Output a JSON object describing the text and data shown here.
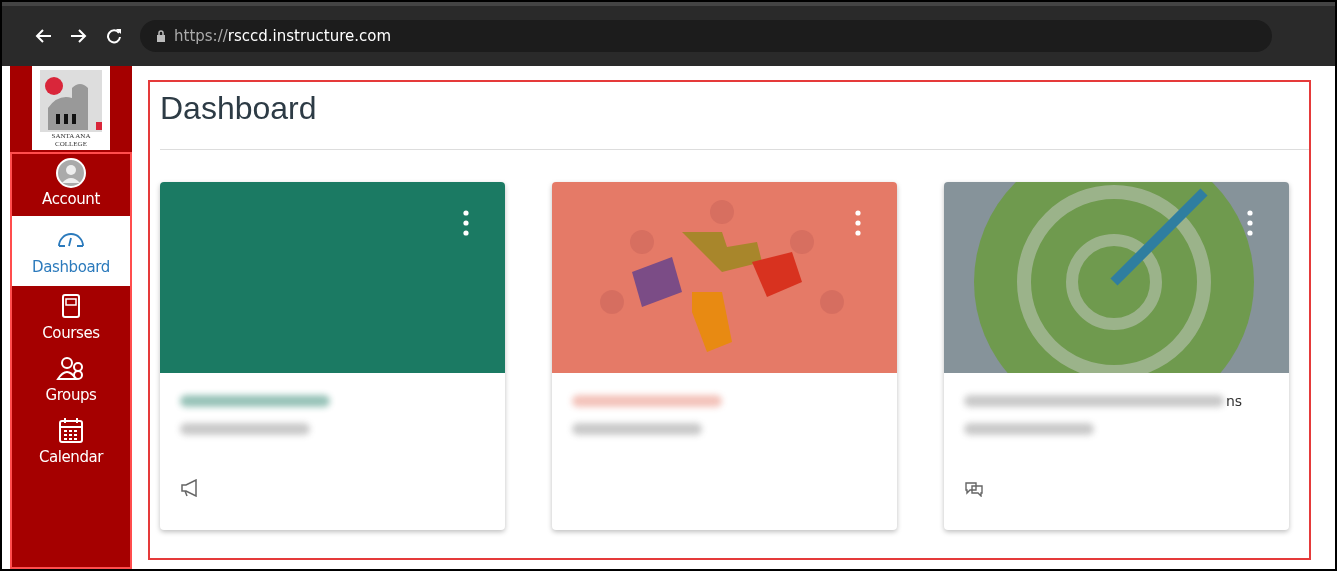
{
  "browser": {
    "url_scheme": "https://",
    "url_host": "rsccd.instructure.com"
  },
  "logo": {
    "text_line_1": "SANTA ANA",
    "text_line_2": "COLLEGE"
  },
  "nav": [
    {
      "kind": "account",
      "label": "Account",
      "selected": false
    },
    {
      "kind": "dashboard",
      "label": "Dashboard",
      "selected": true
    },
    {
      "kind": "courses",
      "label": "Courses",
      "selected": false
    },
    {
      "kind": "groups",
      "label": "Groups",
      "selected": false
    },
    {
      "kind": "calendar",
      "label": "Calendar",
      "selected": false
    }
  ],
  "page": {
    "title": "Dashboard"
  },
  "cards": [
    {
      "kind": "color",
      "color": "#1b7a63"
    },
    {
      "kind": "puzzle",
      "color": "#e57a67"
    },
    {
      "kind": "target",
      "color": "#86939a",
      "title_tail": "ns"
    }
  ]
}
